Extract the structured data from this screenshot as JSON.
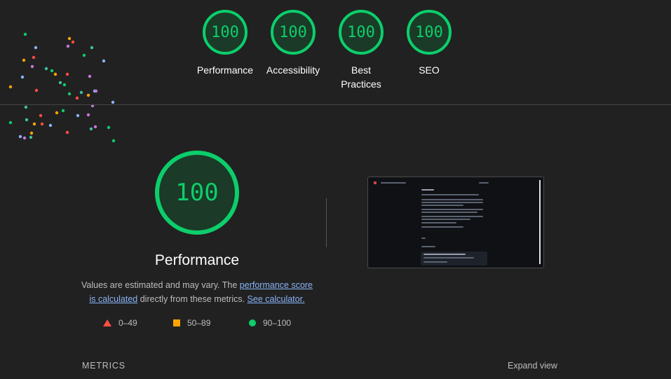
{
  "categories": [
    {
      "score": "100",
      "label": "Performance"
    },
    {
      "score": "100",
      "label": "Accessibility"
    },
    {
      "score": "100",
      "label": "Best Practices"
    },
    {
      "score": "100",
      "label": "SEO"
    }
  ],
  "performance": {
    "score": "100",
    "title": "Performance",
    "description_pre": "Values are estimated and may vary. The ",
    "link_score": "performance score is calculated",
    "description_mid": " directly from these metrics. ",
    "link_calculator": "See calculator."
  },
  "legend": [
    {
      "range": "0–49",
      "shape": "triangle",
      "color": "#ff4e42"
    },
    {
      "range": "50–89",
      "shape": "square",
      "color": "#ffa400"
    },
    {
      "range": "90–100",
      "shape": "circle",
      "color": "#0cce6b"
    }
  ],
  "metrics": {
    "heading": "METRICS",
    "expand_label": "Expand view"
  },
  "colors": {
    "pass": "#0cce6b",
    "background": "#212121",
    "link": "#8ab4f8"
  }
}
